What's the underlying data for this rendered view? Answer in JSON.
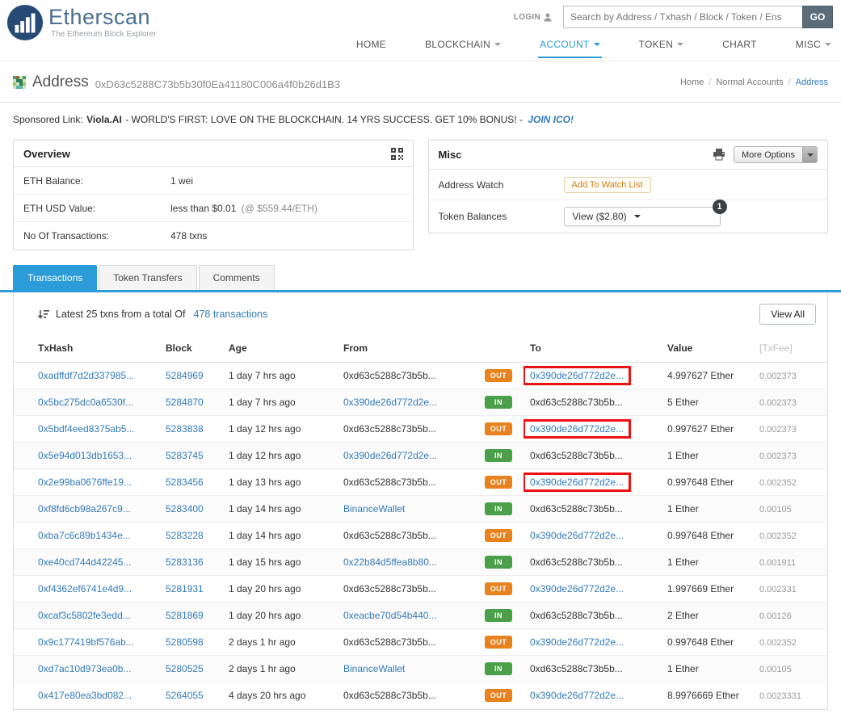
{
  "colors": {
    "link_blue": "#337ab7",
    "tab_blue": "#2b9cd8",
    "out_orange": "#e8821e",
    "in_green": "#4aa048",
    "highlight_red": "#ee1111",
    "go_button": "#5b6d79",
    "badge_dark": "#3b4045",
    "logo_navy": "#264a74",
    "logo_text": "#4a6d91"
  },
  "header": {
    "logo": {
      "title": "Etherscan",
      "subtitle": "The Ethereum Block Explorer"
    },
    "login_label": "LOGIN",
    "search": {
      "placeholder": "Search by Address / Txhash / Block / Token / Ens",
      "button": "GO"
    },
    "nav": [
      {
        "label": "HOME",
        "dropdown": false,
        "active": false
      },
      {
        "label": "BLOCKCHAIN",
        "dropdown": true,
        "active": false
      },
      {
        "label": "ACCOUNT",
        "dropdown": true,
        "active": true
      },
      {
        "label": "TOKEN",
        "dropdown": true,
        "active": false
      },
      {
        "label": "CHART",
        "dropdown": false,
        "active": false
      },
      {
        "label": "MISC",
        "dropdown": true,
        "active": false
      }
    ]
  },
  "page": {
    "title": "Address",
    "address": "0xD63c5288C73b5b30f0Ea41180C006a4f0b26d1B3",
    "breadcrumb": [
      "Home",
      "Normal Accounts",
      "Address"
    ]
  },
  "sponsored": {
    "label": "Sponsored Link:",
    "brand": "Viola.AI",
    "text": "- WORLD'S FIRST: LOVE ON THE BLOCKCHAIN. 14 YRS SUCCESS. GET 10% BONUS! -",
    "cta": "JOIN ICO!"
  },
  "overview": {
    "title": "Overview",
    "rows": [
      {
        "label": "ETH Balance:",
        "value": "1 wei",
        "note": ""
      },
      {
        "label": "ETH USD Value:",
        "value": "less than $0.01",
        "note": "(@ $559.44/ETH)"
      },
      {
        "label": "No Of Transactions:",
        "value": "478 txns",
        "note": ""
      }
    ]
  },
  "misc": {
    "title": "Misc",
    "more_options": "More Options",
    "rows": [
      {
        "label": "Address Watch",
        "control": "Add To Watch List"
      },
      {
        "label": "Token Balances",
        "control": "View ($2.80)",
        "badge": "1"
      }
    ]
  },
  "tabs": [
    {
      "label": "Transactions",
      "active": true
    },
    {
      "label": "Token Transfers",
      "active": false
    },
    {
      "label": "Comments",
      "active": false
    }
  ],
  "transactions": {
    "summary_prefix": "Latest 25 txns from a total Of",
    "summary_link": "478 transactions",
    "view_all": "View All",
    "columns": [
      "TxHash",
      "Block",
      "Age",
      "From",
      "",
      "To",
      "Value",
      "[TxFee]"
    ],
    "rows": [
      {
        "txhash": "0xadffdf7d2d337985...",
        "block": "5284969",
        "age": "1 day 7 hrs ago",
        "from": "0xd63c5288c73b5b...",
        "from_is_link": false,
        "dir": "OUT",
        "to": "0x390de26d772d2e...",
        "to_is_link": true,
        "to_highlighted": true,
        "value": "4.997627 Ether",
        "fee": "0.002373"
      },
      {
        "txhash": "0x5bc275dc0a6530f...",
        "block": "5284870",
        "age": "1 day 7 hrs ago",
        "from": "0x390de26d772d2e...",
        "from_is_link": true,
        "dir": "IN",
        "to": "0xd63c5288c73b5b...",
        "to_is_link": false,
        "to_highlighted": false,
        "value": "5 Ether",
        "fee": "0.002373"
      },
      {
        "txhash": "0x5bdf4eed8375ab5...",
        "block": "5283838",
        "age": "1 day 12 hrs ago",
        "from": "0xd63c5288c73b5b...",
        "from_is_link": false,
        "dir": "OUT",
        "to": "0x390de26d772d2e...",
        "to_is_link": true,
        "to_highlighted": true,
        "value": "0.997627 Ether",
        "fee": "0.002373"
      },
      {
        "txhash": "0x5e94d013db1653...",
        "block": "5283745",
        "age": "1 day 12 hrs ago",
        "from": "0x390de26d772d2e...",
        "from_is_link": true,
        "dir": "IN",
        "to": "0xd63c5288c73b5b...",
        "to_is_link": false,
        "to_highlighted": false,
        "value": "1 Ether",
        "fee": "0.002373"
      },
      {
        "txhash": "0x2e99ba0676ffe19...",
        "block": "5283456",
        "age": "1 day 13 hrs ago",
        "from": "0xd63c5288c73b5b...",
        "from_is_link": false,
        "dir": "OUT",
        "to": "0x390de26d772d2e...",
        "to_is_link": true,
        "to_highlighted": true,
        "value": "0.997648 Ether",
        "fee": "0.002352"
      },
      {
        "txhash": "0xf8fd6cb98a267c9...",
        "block": "5283400",
        "age": "1 day 14 hrs ago",
        "from": "BinanceWallet",
        "from_is_link": true,
        "dir": "IN",
        "to": "0xd63c5288c73b5b...",
        "to_is_link": false,
        "to_highlighted": false,
        "value": "1 Ether",
        "fee": "0.00105"
      },
      {
        "txhash": "0xba7c6c89b1434e...",
        "block": "5283228",
        "age": "1 day 14 hrs ago",
        "from": "0xd63c5288c73b5b...",
        "from_is_link": false,
        "dir": "OUT",
        "to": "0x390de26d772d2e...",
        "to_is_link": true,
        "to_highlighted": false,
        "value": "0.997648 Ether",
        "fee": "0.002352"
      },
      {
        "txhash": "0xe40cd744d42245...",
        "block": "5283136",
        "age": "1 day 15 hrs ago",
        "from": "0x22b84d5ffea8b80...",
        "from_is_link": true,
        "dir": "IN",
        "to": "0xd63c5288c73b5b...",
        "to_is_link": false,
        "to_highlighted": false,
        "value": "1 Ether",
        "fee": "0.001911"
      },
      {
        "txhash": "0xf4362ef6741e4d9...",
        "block": "5281931",
        "age": "1 day 20 hrs ago",
        "from": "0xd63c5288c73b5b...",
        "from_is_link": false,
        "dir": "OUT",
        "to": "0x390de26d772d2e...",
        "to_is_link": true,
        "to_highlighted": false,
        "value": "1.997669 Ether",
        "fee": "0.002331"
      },
      {
        "txhash": "0xcaf3c5802fe3edd...",
        "block": "5281869",
        "age": "1 day 20 hrs ago",
        "from": "0xeacbe70d54b440...",
        "from_is_link": true,
        "dir": "IN",
        "to": "0xd63c5288c73b5b...",
        "to_is_link": false,
        "to_highlighted": false,
        "value": "2 Ether",
        "fee": "0.00126"
      },
      {
        "txhash": "0x9c177419bf576ab...",
        "block": "5280598",
        "age": "2 days 1 hr ago",
        "from": "0xd63c5288c73b5b...",
        "from_is_link": false,
        "dir": "OUT",
        "to": "0x390de26d772d2e...",
        "to_is_link": true,
        "to_highlighted": false,
        "value": "0.997648 Ether",
        "fee": "0.002352"
      },
      {
        "txhash": "0xd7ac10d973ea0b...",
        "block": "5280525",
        "age": "2 days 1 hr ago",
        "from": "BinanceWallet",
        "from_is_link": true,
        "dir": "IN",
        "to": "0xd63c5288c73b5b...",
        "to_is_link": false,
        "to_highlighted": false,
        "value": "1 Ether",
        "fee": "0.00105"
      },
      {
        "txhash": "0x417e80ea3bd082...",
        "block": "5264055",
        "age": "4 days 20 hrs ago",
        "from": "0xd63c5288c73b5b...",
        "from_is_link": false,
        "dir": "OUT",
        "to": "0x390de26d772d2e...",
        "to_is_link": true,
        "to_highlighted": false,
        "value": "8.9976669 Ether",
        "fee": "0.0023331"
      }
    ]
  }
}
